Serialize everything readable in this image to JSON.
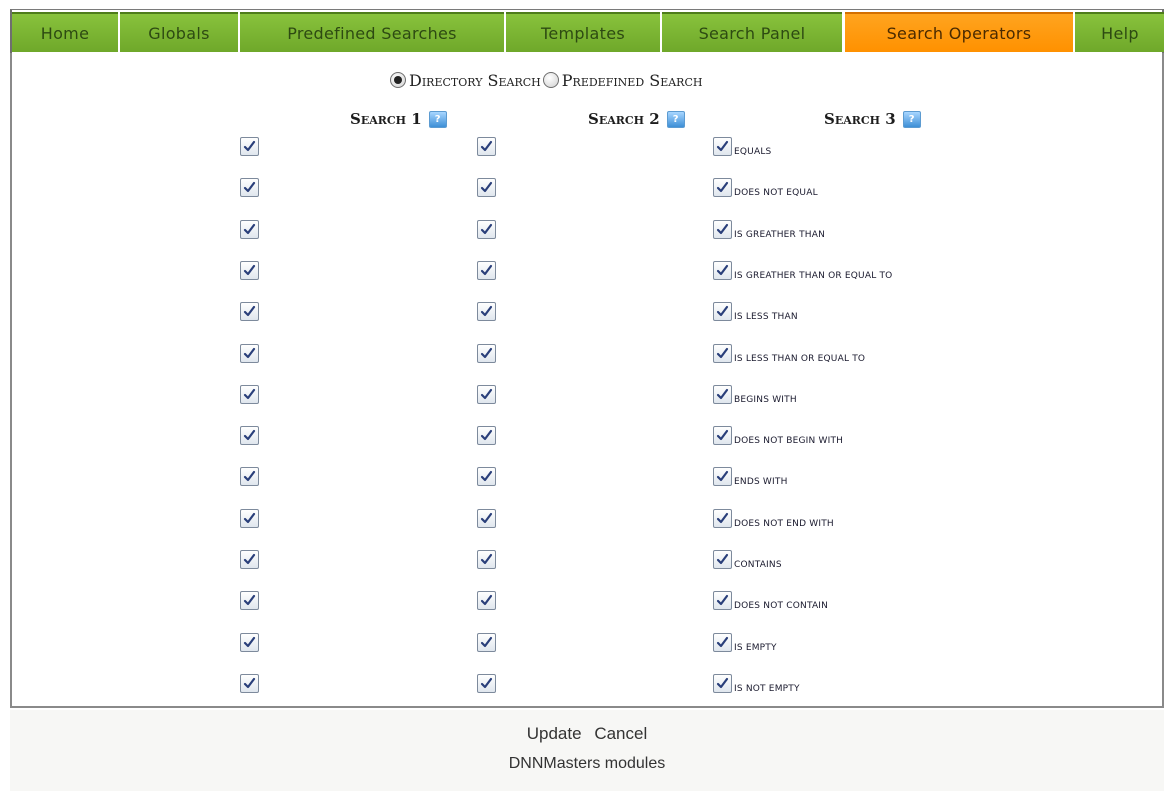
{
  "tabs": [
    {
      "label": "Home",
      "active": false
    },
    {
      "label": "Globals",
      "active": false
    },
    {
      "label": "Predefined Searches",
      "active": false
    },
    {
      "label": "Templates",
      "active": false
    },
    {
      "label": "Search Panel",
      "active": false
    },
    {
      "label": "Search Operators",
      "active": true
    },
    {
      "label": "Help",
      "active": false
    }
  ],
  "search_type": {
    "options": [
      "Directory Search",
      "Predefined Search"
    ],
    "selected": "Directory Search"
  },
  "columns": [
    "Search 1",
    "Search 2",
    "Search 3"
  ],
  "operators": [
    "equals",
    "does not equal",
    "is greather than",
    "is greather than or equal to",
    "is less than",
    "is less than or equal to",
    "begins with",
    "does not begin with",
    "ends with",
    "does not end with",
    "contains",
    "does not contain",
    "is empty",
    "is not empty"
  ],
  "checked": true,
  "help_icon": "help-icon",
  "actions": {
    "update": "Update",
    "cancel": "Cancel"
  },
  "credit": "DNNMasters modules",
  "colors": {
    "tab_green": "#7ab833",
    "tab_active": "#ff9a10",
    "help_blue": "#3d8fd6"
  }
}
